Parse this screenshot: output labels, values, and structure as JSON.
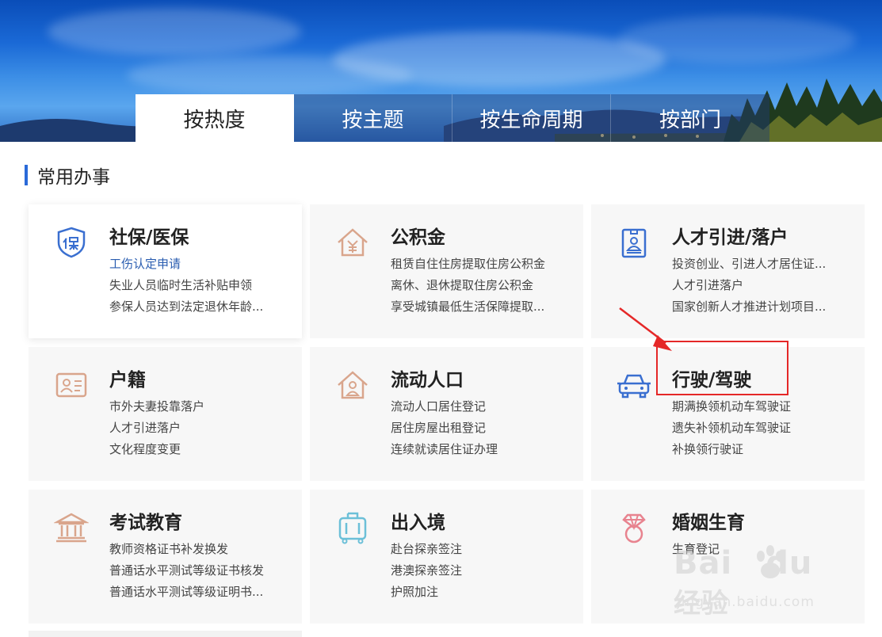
{
  "tabs": [
    {
      "label": "按热度",
      "active": true
    },
    {
      "label": "按主题",
      "active": false
    },
    {
      "label": "按生命周期",
      "active": false
    },
    {
      "label": "按部门",
      "active": false
    }
  ],
  "section": {
    "title": "常用办事"
  },
  "cards": [
    {
      "title": "社保/医保",
      "icon": "shield-bao-icon",
      "highlight": true,
      "items": [
        "工伤认定申请",
        "失业人员临时生活补贴申领",
        "参保人员达到法定退休年龄..."
      ],
      "link_first": true
    },
    {
      "title": "公积金",
      "icon": "house-yuan-icon",
      "items": [
        "租赁自住住房提取住房公积金",
        "离休、退休提取住房公积金",
        "享受城镇最低生活保障提取..."
      ]
    },
    {
      "title": "人才引进/落户",
      "icon": "id-badge-icon",
      "items": [
        "投资创业、引进人才居住证...",
        "人才引进落户",
        "国家创新人才推进计划项目..."
      ]
    },
    {
      "title": "户籍",
      "icon": "id-card-icon",
      "items": [
        "市外夫妻投靠落户",
        "人才引进落户",
        "文化程度变更"
      ]
    },
    {
      "title": "流动人口",
      "icon": "house-person-icon",
      "items": [
        "流动人口居住登记",
        "居住房屋出租登记",
        "连续就读居住证办理"
      ]
    },
    {
      "title": "行驶/驾驶",
      "icon": "car-icon",
      "items": [
        "期满换领机动车驾驶证",
        "遗失补领机动车驾驶证",
        "补换领行驶证"
      ]
    },
    {
      "title": "考试教育",
      "icon": "institution-icon",
      "items": [
        "教师资格证书补发换发",
        "普通话水平测试等级证书核发",
        "普通话水平测试等级证明书..."
      ]
    },
    {
      "title": "出入境",
      "icon": "luggage-icon",
      "items": [
        "赴台探亲签注",
        "港澳探亲签注",
        "护照加注"
      ]
    },
    {
      "title": "婚姻生育",
      "icon": "ring-icon",
      "items": [
        "生育登记"
      ]
    }
  ],
  "colors": {
    "accent": "#2a6ad8",
    "link": "#2a5db0",
    "icon": "#d9a58c",
    "annotation": "#e52828"
  },
  "watermark": {
    "logo": "Bai",
    "logo_suffix": "du",
    "cn": "经验",
    "sub": "jingyan.baidu.com"
  }
}
